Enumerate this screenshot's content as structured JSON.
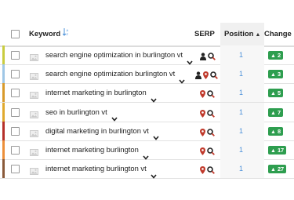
{
  "header": {
    "keyword_label": "Keyword",
    "serp_label": "SERP",
    "position_label": "Position",
    "change_label": "Change"
  },
  "colors": {
    "accent_blue": "#4a90d9",
    "change_green": "#2e9e4f",
    "pin_red": "#c0392b"
  },
  "rows": [
    {
      "keyword": "search engine optimization in burlington vt",
      "serp_icons": [
        "user-icon",
        "search-icon"
      ],
      "position": "1",
      "change": "2",
      "stripe": "#c9cc3f"
    },
    {
      "keyword": "search engine optimization burlington vt",
      "serp_icons": [
        "user-icon",
        "map-pin-icon",
        "search-icon"
      ],
      "position": "1",
      "change": "3",
      "stripe": "#9fc7e6"
    },
    {
      "keyword": "internet marketing in burlington",
      "serp_icons": [
        "map-pin-icon",
        "search-icon"
      ],
      "position": "1",
      "change": "5",
      "stripe": "#d89a2b"
    },
    {
      "keyword": "seo in burlington vt",
      "serp_icons": [
        "map-pin-icon",
        "search-icon"
      ],
      "position": "1",
      "change": "7",
      "stripe": "#e0a92e"
    },
    {
      "keyword": "digital marketing in burlington vt",
      "serp_icons": [
        "map-pin-icon",
        "search-icon"
      ],
      "position": "1",
      "change": "8",
      "stripe": "#b5302a"
    },
    {
      "keyword": "internet marketing burlington",
      "serp_icons": [
        "map-pin-icon",
        "search-icon"
      ],
      "position": "1",
      "change": "17",
      "stripe": "#ec8f3a"
    },
    {
      "keyword": "internet marketing burlington vt",
      "serp_icons": [
        "map-pin-icon",
        "search-icon"
      ],
      "position": "1",
      "change": "27",
      "stripe": "#8a5a3a"
    }
  ]
}
